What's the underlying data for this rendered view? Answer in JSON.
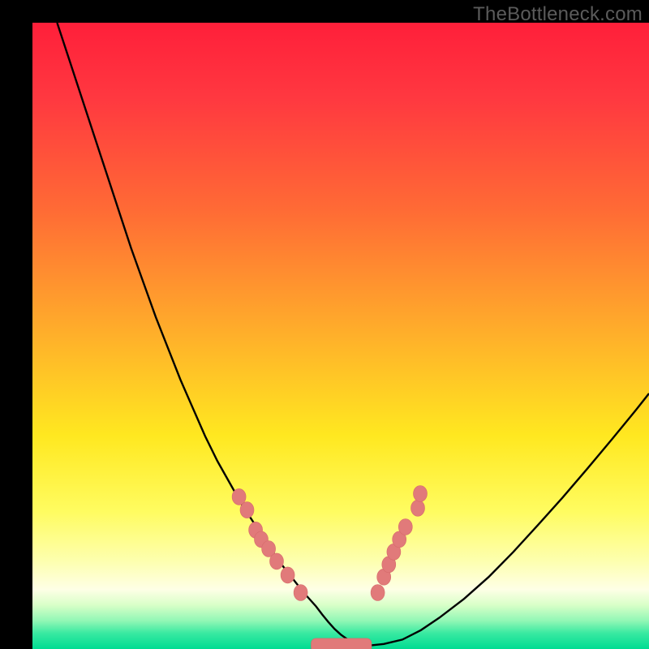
{
  "watermark": "TheBottleneck.com",
  "chart_data": {
    "type": "line",
    "title": "",
    "xlabel": "",
    "ylabel": "",
    "xlim": [
      0,
      100
    ],
    "ylim": [
      0,
      100
    ],
    "axes_visible": false,
    "grid": false,
    "legend": false,
    "background_gradient_stops": [
      {
        "pos": 0.0,
        "color": "#ff1f3a"
      },
      {
        "pos": 0.12,
        "color": "#ff3840"
      },
      {
        "pos": 0.3,
        "color": "#ff6b35"
      },
      {
        "pos": 0.5,
        "color": "#ffb02a"
      },
      {
        "pos": 0.66,
        "color": "#ffe820"
      },
      {
        "pos": 0.78,
        "color": "#fffc60"
      },
      {
        "pos": 0.86,
        "color": "#fdffaf"
      },
      {
        "pos": 0.905,
        "color": "#feffe6"
      },
      {
        "pos": 0.93,
        "color": "#d8ffc8"
      },
      {
        "pos": 0.955,
        "color": "#91f7b5"
      },
      {
        "pos": 0.975,
        "color": "#38e9a1"
      },
      {
        "pos": 1.0,
        "color": "#00dc92"
      }
    ],
    "series": [
      {
        "name": "bottleneck-curve",
        "x": [
          4,
          6,
          8,
          10,
          12,
          14,
          16,
          18,
          20,
          22,
          24,
          26,
          28,
          30,
          32,
          34,
          36,
          38,
          40,
          42,
          44,
          46,
          47,
          48,
          49,
          50,
          51,
          52,
          53,
          55,
          57,
          60,
          63,
          66,
          70,
          74,
          78,
          82,
          86,
          90,
          94,
          98,
          100
        ],
        "y": [
          100,
          94,
          88,
          82,
          76,
          70,
          64,
          58.5,
          53,
          48,
          43,
          38.5,
          34,
          30,
          26.5,
          23,
          20,
          17,
          14,
          11.5,
          9,
          6.8,
          5.5,
          4.3,
          3.2,
          2.3,
          1.6,
          1.1,
          0.8,
          0.6,
          0.8,
          1.5,
          3,
          5,
          8,
          11.5,
          15.5,
          19.8,
          24.2,
          28.8,
          33.5,
          38.3,
          40.8
        ]
      }
    ],
    "markers_left": [
      {
        "x": 33.5,
        "y": 24.3
      },
      {
        "x": 34.8,
        "y": 22.2
      },
      {
        "x": 36.2,
        "y": 19.0
      },
      {
        "x": 37.1,
        "y": 17.5
      },
      {
        "x": 38.3,
        "y": 16.0
      },
      {
        "x": 39.6,
        "y": 14.0
      },
      {
        "x": 41.4,
        "y": 11.8
      },
      {
        "x": 43.5,
        "y": 9.0
      }
    ],
    "markers_right": [
      {
        "x": 56.0,
        "y": 9.0
      },
      {
        "x": 57.0,
        "y": 11.5
      },
      {
        "x": 57.8,
        "y": 13.5
      },
      {
        "x": 58.6,
        "y": 15.5
      },
      {
        "x": 59.5,
        "y": 17.5
      },
      {
        "x": 60.5,
        "y": 19.5
      },
      {
        "x": 62.5,
        "y": 22.5
      },
      {
        "x": 62.9,
        "y": 24.8
      }
    ],
    "flat_segment": {
      "x0": 45.2,
      "x1": 55.0,
      "y": 0.6,
      "thickness": 2.2
    }
  }
}
